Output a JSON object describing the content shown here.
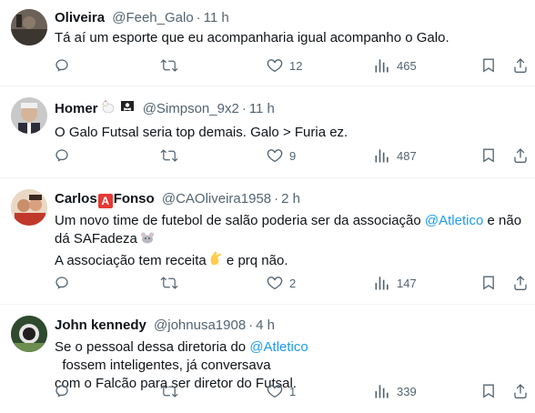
{
  "tweets": [
    {
      "name": "Oliveira",
      "handle": "@Feeh_Galo",
      "time": "11 h",
      "text_lines": [
        "Tá aí um esporte que eu acompanharia igual acompanho o Galo."
      ],
      "stats": {
        "reply": "",
        "repost": "",
        "like": "12",
        "views": "465"
      }
    },
    {
      "name": "Homer",
      "name_emojis": [
        "rooster-emoji",
        "pirate-flag-emoji"
      ],
      "handle": "@Simpson_9x2",
      "time": "11 h",
      "text_lines": [
        "O Galo Futsal seria top demais. Galo > Furia ez."
      ],
      "stats": {
        "reply": "",
        "repost": "",
        "like": "9",
        "views": "487"
      }
    },
    {
      "name_a": "Carlos",
      "name_b": "Fonso",
      "name_badge": "A",
      "handle": "@CAOliveira1958",
      "time": "2 h",
      "line1_pre": "Um novo time de futebol de salão poderia ser da associação ",
      "line1_mention": "@Atletico",
      "line1_post": " e não",
      "line2": "dá SAFadeza",
      "line2_emoji": "rat-emoji",
      "line3_pre": "A associação tem receita",
      "line3_emoji": "pinching-hand-emoji",
      "line3_post": " e prq não.",
      "stats": {
        "reply": "",
        "repost": "",
        "like": "2",
        "views": "147"
      }
    },
    {
      "name": "John kennedy",
      "handle": "@johnusa1908",
      "time": "4 h",
      "line1_pre": "Se o pessoal dessa diretoria do ",
      "line1_mention": "@Atletico",
      "line1_post": "  fossem inteligentes, já conversava",
      "line2": "com o Falcão para ser diretor do Futsal.",
      "stats": {
        "reply": "",
        "repost": "",
        "like": "1",
        "views": "339"
      }
    }
  ],
  "sep": "·",
  "colors": {
    "text": "#0f1419",
    "muted": "#536471",
    "link": "#1d9bf0",
    "border": "#eff3f4"
  }
}
